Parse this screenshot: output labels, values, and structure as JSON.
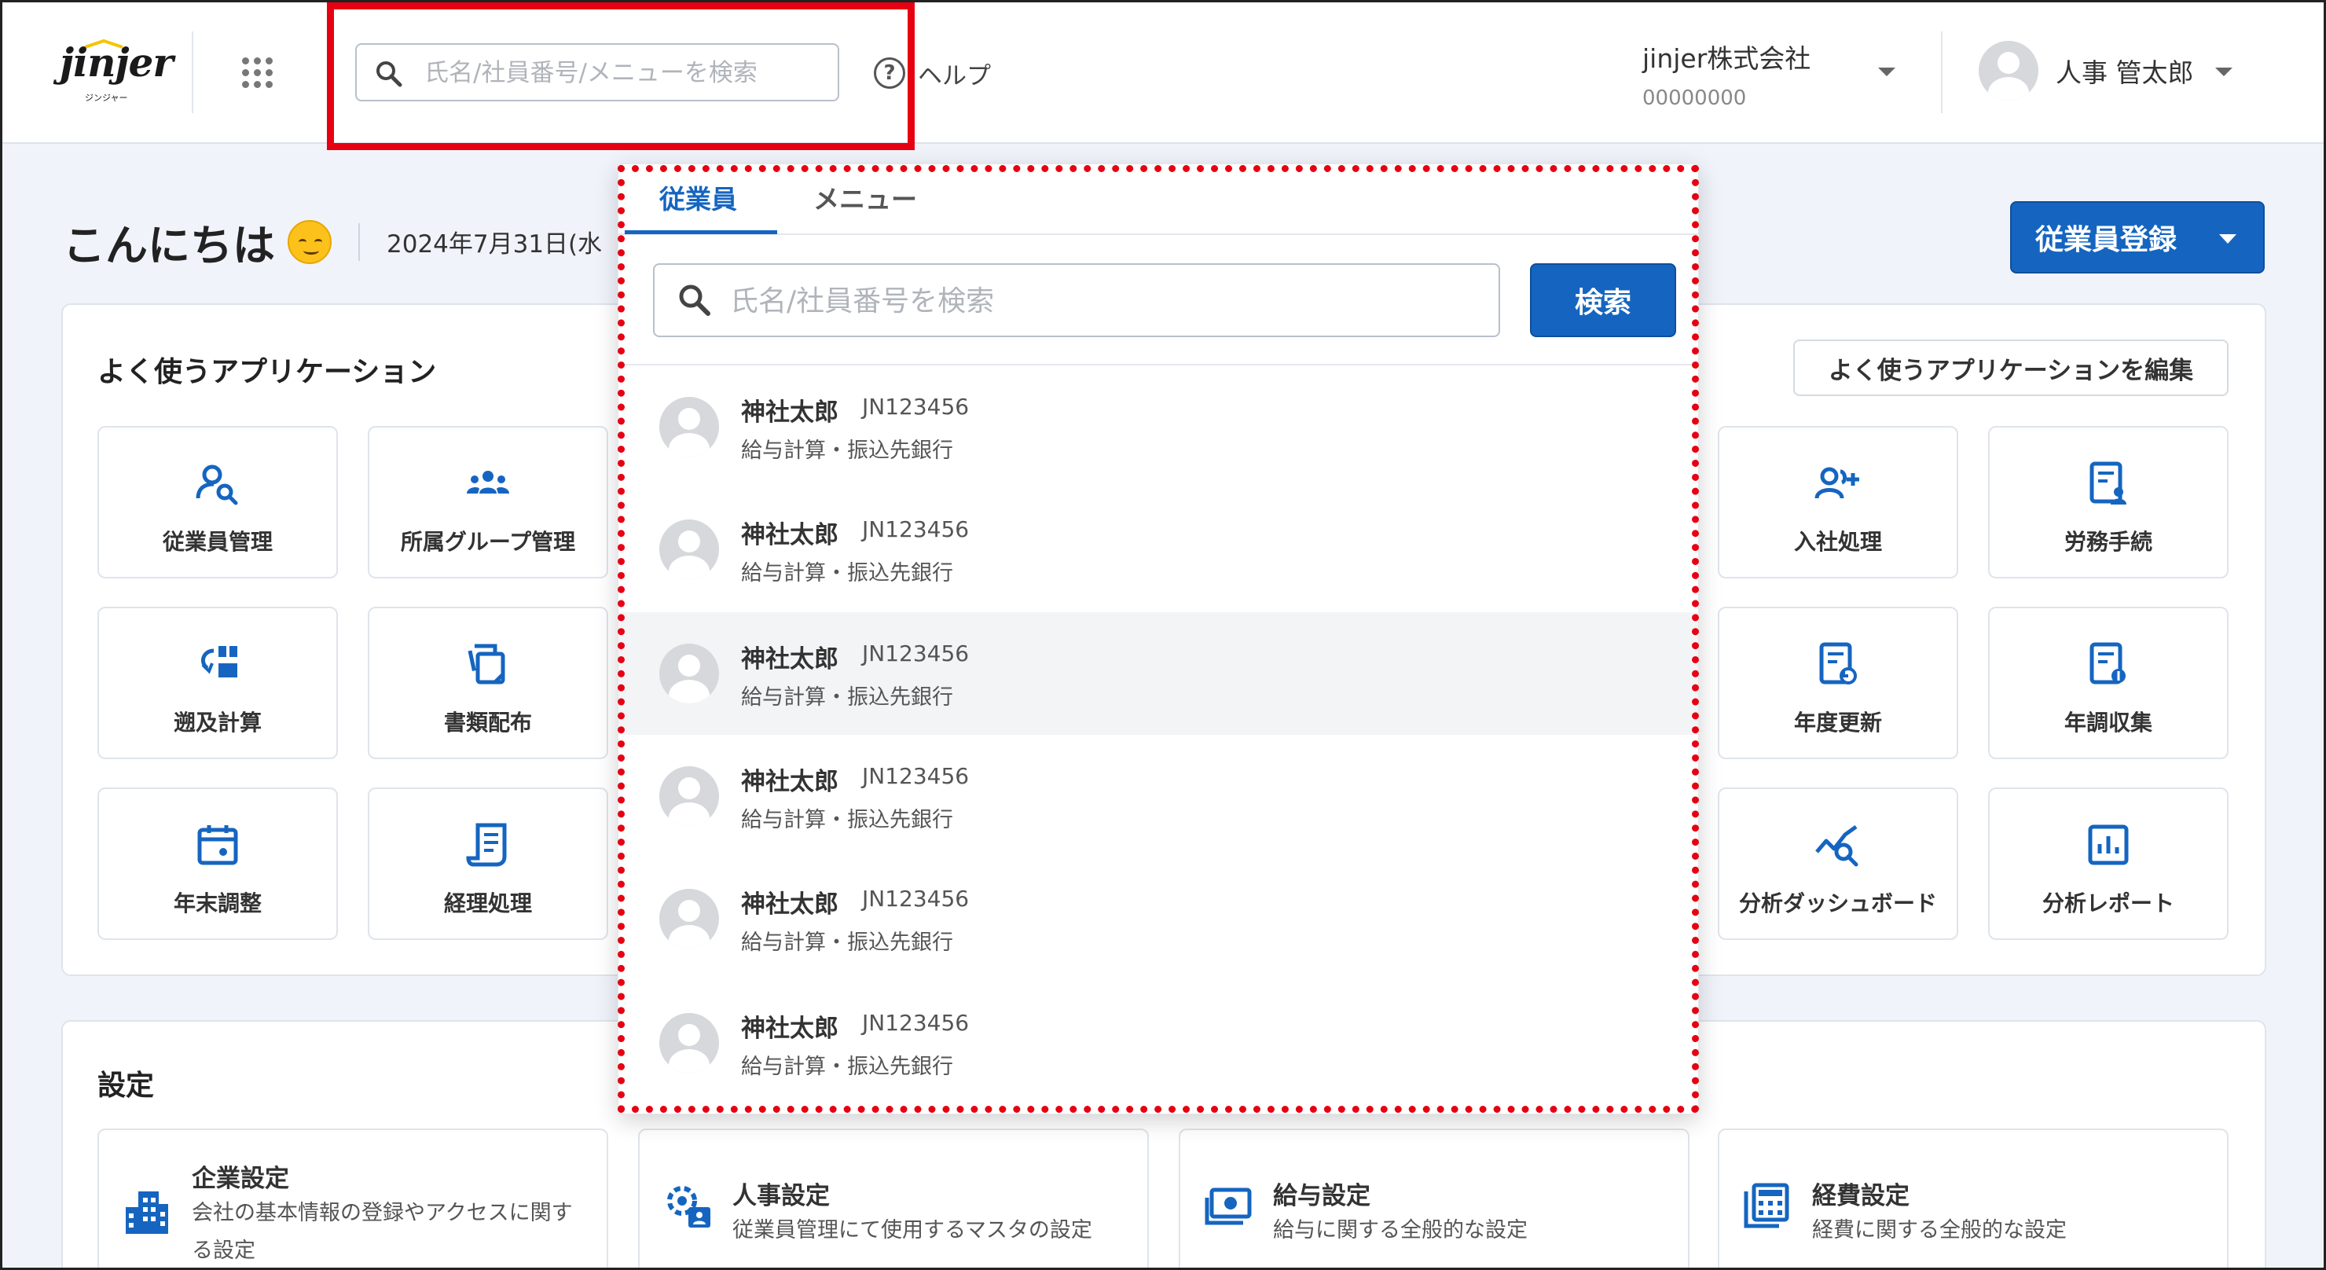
{
  "header": {
    "logo_text": "jinjer",
    "logo_sub": "ジンジャー",
    "search_placeholder": "氏名/社員番号/メニューを検索",
    "help_label": "ヘルプ",
    "company_name": "jinjer株式会社",
    "company_code": "00000000",
    "user_name": "人事 管太郎"
  },
  "main": {
    "greeting": "こんにちは",
    "date": "2024年7月31日(水",
    "register_button": "従業員登録",
    "apps_title": "よく使うアプリケーション",
    "edit_apps_button": "よく使うアプリケーションを編集",
    "apps": [
      {
        "label": "従業員管理",
        "icon": "employee-search-icon"
      },
      {
        "label": "所属グループ管理",
        "icon": "group-icon"
      },
      {
        "label": "入社処理",
        "icon": "user-add-icon"
      },
      {
        "label": "労務手続",
        "icon": "labor-document-icon"
      },
      {
        "label": "遡及計算",
        "icon": "retro-calc-icon"
      },
      {
        "label": "書類配布",
        "icon": "documents-icon"
      },
      {
        "label": "年度更新",
        "icon": "annual-update-icon"
      },
      {
        "label": "年調収集",
        "icon": "year-end-collect-icon"
      },
      {
        "label": "年末調整",
        "icon": "calendar-icon"
      },
      {
        "label": "経理処理",
        "icon": "receipt-icon"
      },
      {
        "label": "分析ダッシュボード",
        "icon": "analytics-icon"
      },
      {
        "label": "分析レポート",
        "icon": "report-chart-icon"
      }
    ],
    "settings_title": "設定",
    "settings": [
      {
        "title": "企業設定",
        "desc": "会社の基本情報の登録やアクセスに関する設定",
        "icon": "building-icon"
      },
      {
        "title": "人事設定",
        "desc": "従業員管理にて使用するマスタの設定",
        "icon": "hr-settings-icon"
      },
      {
        "title": "給与設定",
        "desc": "給与に関する全般的な設定",
        "icon": "money-icon"
      },
      {
        "title": "経費設定",
        "desc": "経費に関する全般的な設定",
        "icon": "calculator-icon"
      }
    ]
  },
  "dropdown": {
    "tabs": [
      {
        "label": "従業員",
        "active": true
      },
      {
        "label": "メニュー",
        "active": false
      }
    ],
    "search_placeholder": "氏名/社員番号を検索",
    "search_button": "検索",
    "results": [
      {
        "name": "神社太郎",
        "id": "JN123456",
        "dept": "給与計算・振込先銀行",
        "highlighted": false
      },
      {
        "name": "神社太郎",
        "id": "JN123456",
        "dept": "給与計算・振込先銀行",
        "highlighted": false
      },
      {
        "name": "神社太郎",
        "id": "JN123456",
        "dept": "給与計算・振込先銀行",
        "highlighted": true
      },
      {
        "name": "神社太郎",
        "id": "JN123456",
        "dept": "給与計算・振込先銀行",
        "highlighted": false
      },
      {
        "name": "神社太郎",
        "id": "JN123456",
        "dept": "給与計算・振込先銀行",
        "highlighted": false
      },
      {
        "name": "神社太郎",
        "id": "JN123456",
        "dept": "給与計算・振込先銀行",
        "highlighted": false
      }
    ]
  },
  "colors": {
    "brand_blue": "#1565c0",
    "annotation_red": "#e60012"
  }
}
